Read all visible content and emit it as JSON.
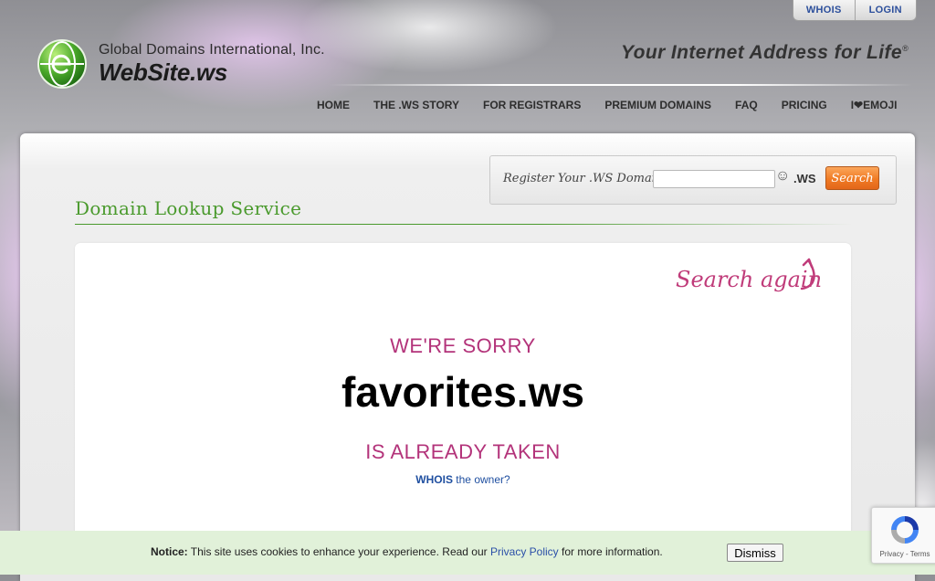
{
  "top_links": {
    "whois": "WHOIS",
    "login": "LOGIN"
  },
  "logo": {
    "line1": "Global Domains International, Inc.",
    "line2": "WebSite.ws"
  },
  "tagline": {
    "text": "Your Internet Address for Life",
    "mark": "®"
  },
  "nav": {
    "items": [
      {
        "label": "HOME"
      },
      {
        "label": "THE .WS STORY"
      },
      {
        "label": "FOR REGISTRARS"
      },
      {
        "label": "PREMIUM DOMAINS"
      },
      {
        "label": "FAQ"
      },
      {
        "label": "PRICING"
      },
      {
        "label": "I❤EMOJI"
      }
    ]
  },
  "register": {
    "label": "Register Your .WS Domain",
    "input_value": "",
    "smiley": "☺",
    "tld": ".WS",
    "button": "Search"
  },
  "page_title": "Domain Lookup Service",
  "result": {
    "search_again": "Search again",
    "sorry": "WE'RE SORRY",
    "domain": "favorites.ws",
    "taken": "IS ALREADY TAKEN",
    "whois_bold": "WHOIS",
    "whois_rest": " the owner?"
  },
  "cookie": {
    "notice_label": "Notice:",
    "text_before": " This site uses cookies to enhance your experience. Read our ",
    "link": "Privacy Policy",
    "text_after": " for more information.",
    "dismiss": "Dismiss"
  },
  "recaptcha": {
    "privacy": "Privacy",
    "sep": " - ",
    "terms": "Terms"
  },
  "colors": {
    "accent_green": "#4a9a2d",
    "accent_pink": "#b3337a",
    "link_blue": "#1f4fa0",
    "search_orange": "#f07b24"
  }
}
